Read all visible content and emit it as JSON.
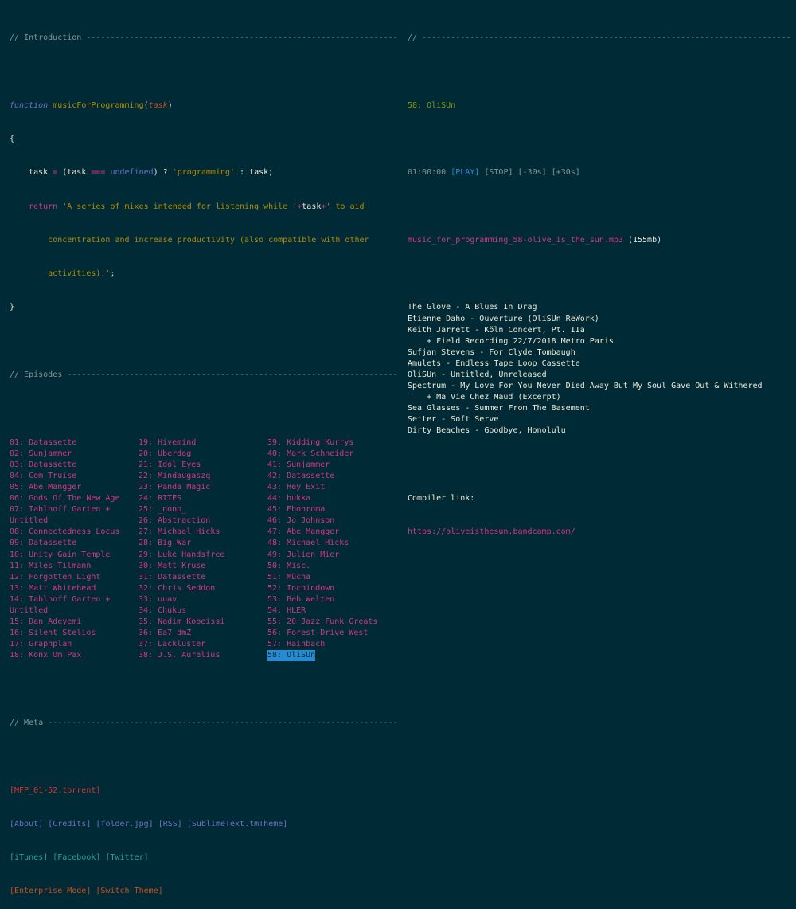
{
  "intro": {
    "header": "// Introduction -----------------------------------------------------------------",
    "code": {
      "kw_function": "function",
      "fn_name": "musicForProgramming",
      "paren_open": "(",
      "param": "task",
      "paren_close": ")",
      "brace_open": "{",
      "l1_a": "    task ",
      "l1_eq": "=",
      "l1_b": " (task ",
      "l1_eqq": "===",
      "l1_c": " ",
      "l1_undef": "undefined",
      "l1_d": ") ? ",
      "l1_str": "'programming'",
      "l1_e": " : task;",
      "l2_ret": "    return",
      "l2_s1": " 'A series of mixes intended for listening while '",
      "l2_plus1": "+",
      "l2_task": "task",
      "l2_plus2": "+",
      "l2_s2": "' to aid",
      "l3": "        concentration and increase productivity (also compatible with other",
      "l4": "        activities).'",
      "l4_end": ";",
      "brace_close": "}"
    }
  },
  "episodes": {
    "header": "// Episodes ---------------------------------------------------------------------",
    "col1": [
      "01: Datassette",
      "02: Sunjammer",
      "03: Datassette",
      "04: Com Truise",
      "05: Abe Mangger",
      "06: Gods Of The New Age",
      "07: Tahlhoff Garten + Untitled",
      "08: Connectedness Locus",
      "09: Datassette",
      "10: Unity Gain Temple",
      "11: Miles Tilmann",
      "12: Forgotten Light",
      "13: Matt Whitehead",
      "14: Tahlhoff Garten + Untitled",
      "15: Dan Adeyemi",
      "16: Silent Stelios",
      "17: Graphplan",
      "18: Konx Om Pax"
    ],
    "col2": [
      "19: Hivemind",
      "20: Uberdog",
      "21: Idol Eyes",
      "22: Mindaugaszq",
      "23: Panda Magic",
      "24: RITES",
      "25: _nono_",
      "26: Abstraction",
      "27: Michael Hicks",
      "28: Big War",
      "29: Luke Handsfree",
      "30: Matt Kruse",
      "31: Datassette",
      "32: Chris Seddon",
      "33: uuav",
      "34: Chukus",
      "35: Nadim Kobeissi",
      "36: Ea7_dmZ",
      "37: Lackluster",
      "38: J.S. Aurelius"
    ],
    "col3": [
      "39: Kidding Kurrys",
      "40: Mark Schneider",
      "41: Sunjammer",
      "42: Datassette",
      "43: Hey Exit",
      "44: hukka",
      "45: Ehohroma",
      "46: Jo Johnson",
      "47: Abe Mangger",
      "48: Michael Hicks",
      "49: Julien Mier",
      "50: Misc.",
      "51: Mücha",
      "52: Inchindown",
      "53: Beb Welten",
      "54: HLER",
      "55: 20 Jazz Funk Greats",
      "56: Forest Drive West",
      "57: Hainbach",
      "58: OliSUn"
    ],
    "active": "58: OliSUn"
  },
  "meta": {
    "header": "// Meta -------------------------------------------------------------------------",
    "torrent": "[MFP_01-52.torrent]",
    "row2": [
      "[About]",
      "[Credits]",
      "[folder.jpg]",
      "[RSS]",
      "[SublimeText.tmTheme]"
    ],
    "row3": [
      "[iTunes]",
      "[Facebook]",
      "[Twitter]"
    ],
    "row4": [
      "[Enterprise Mode]",
      "[Switch Theme]"
    ]
  },
  "player": {
    "header": "// ------------------------------------------------------------------------------",
    "title": "58: OliSUn",
    "time": "01:00:00",
    "play": "[PLAY]",
    "stop": "[STOP]",
    "back": "[-30s]",
    "fwd": "[+30s]",
    "file": "music_for_programming_58-olive_is_the_sun.mp3",
    "size": "(155mb)",
    "tracks": [
      "The Glove - A Blues In Drag",
      "Etienne Daho - Ouverture (OliSUn ReWork)",
      "Keith Jarrett - Köln Concert, Pt. IIa",
      "    + Field Recording 22/7/2018 Metro Paris",
      "Sufjan Stevens - For Clyde Tombaugh",
      "Amulets - Endless Tape Loop Cassette",
      "OliSUn - Untitled, Unreleased",
      "Spectrum - My Love For You Never Died Away But My Soul Gave Out & Withered",
      "    + Ma Vie Chez Maud (Excerpt)",
      "Sea Glasses - Summer From The Basement",
      "Setter - Soft Serve",
      "Dirty Beaches - Goodbye, Honolulu"
    ],
    "compiler_label": "Compiler link:",
    "compiler_url": "https://oliveisthesun.bandcamp.com/"
  }
}
